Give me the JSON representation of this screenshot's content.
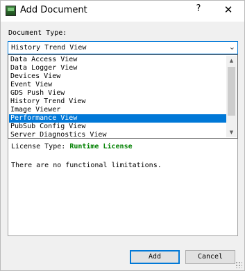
{
  "window": {
    "title": "Add Document",
    "help_glyph": "?",
    "close_glyph": "✕"
  },
  "form": {
    "doc_type_label": "Document Type:",
    "selected_value": "History Trend View",
    "options": [
      "Data Access View",
      "Data Logger View",
      "Devices View",
      "Event View",
      "GDS Push View",
      "History Trend View",
      "Image Viewer",
      "Performance View",
      "PubSub Config View",
      "Server Diagnostics View"
    ],
    "highlighted_index": 7
  },
  "info": {
    "license_label": "License Type:",
    "license_value": "Runtime License",
    "limitations_text": "There are no functional limitations."
  },
  "buttons": {
    "add": "Add",
    "cancel": "Cancel"
  },
  "icons": {
    "app": "app-icon",
    "dropdown": "chevron-down-icon",
    "scroll_up": "scroll-up-arrow-icon",
    "scroll_down": "scroll-down-arrow-icon"
  },
  "colors": {
    "selection": "#0078d7",
    "license_value": "#008000"
  }
}
